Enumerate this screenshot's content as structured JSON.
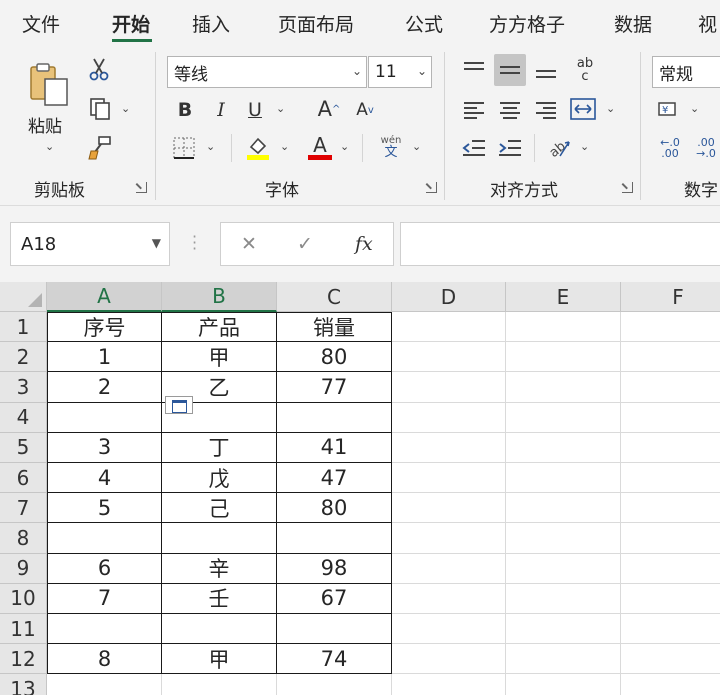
{
  "tabs": [
    "文件",
    "开始",
    "插入",
    "页面布局",
    "公式",
    "方方格子",
    "数据",
    "视"
  ],
  "active_tab": "开始",
  "ribbon": {
    "clipboard": {
      "paste_label": "粘贴",
      "group_label": "剪贴板"
    },
    "font": {
      "font_name": "等线",
      "font_size": "11",
      "group_label": "字体",
      "phonetic_top": "wén",
      "phonetic_bottom": "文",
      "fill_color": "#ffff00",
      "font_color": "#e00000"
    },
    "alignment": {
      "group_label": "对齐方式",
      "wrap_glyph_top": "ab",
      "wrap_glyph_bottom": "c"
    },
    "number": {
      "format": "常规",
      "group_label": "数字"
    }
  },
  "formula_bar": {
    "name_box": "A18",
    "cancel_glyph": "✕",
    "enter_glyph": "✓",
    "fx_glyph": "fx",
    "formula": ""
  },
  "columns": [
    "A",
    "B",
    "C",
    "D",
    "E",
    "F"
  ],
  "rows": [
    {
      "num": "1",
      "cells": [
        "序号",
        "产品",
        "销量"
      ]
    },
    {
      "num": "2",
      "cells": [
        "1",
        "甲",
        "80"
      ]
    },
    {
      "num": "3",
      "cells": [
        "2",
        "乙",
        "77"
      ]
    },
    {
      "num": "4",
      "cells": [
        "",
        "",
        ""
      ]
    },
    {
      "num": "5",
      "cells": [
        "3",
        "丁",
        "41"
      ]
    },
    {
      "num": "6",
      "cells": [
        "4",
        "戊",
        "47"
      ]
    },
    {
      "num": "7",
      "cells": [
        "5",
        "己",
        "80"
      ]
    },
    {
      "num": "8",
      "cells": [
        "",
        "",
        ""
      ]
    },
    {
      "num": "9",
      "cells": [
        "6",
        "辛",
        "98"
      ]
    },
    {
      "num": "10",
      "cells": [
        "7",
        "壬",
        "67"
      ]
    },
    {
      "num": "11",
      "cells": [
        "",
        "",
        ""
      ]
    },
    {
      "num": "12",
      "cells": [
        "8",
        "甲",
        "74"
      ]
    },
    {
      "num": "13",
      "cells": [
        "",
        "",
        ""
      ]
    }
  ],
  "colors": {
    "accent": "#217346",
    "ribbon_bg": "#f3f3f3",
    "header_bg": "#e6e6e6"
  }
}
